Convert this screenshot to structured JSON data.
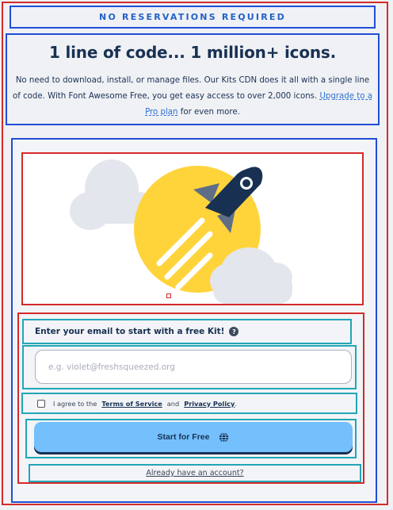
{
  "kicker": "NO RESERVATIONS REQUIRED",
  "intro": {
    "heading": "1 line of code... 1 million+ icons.",
    "body": "No need to download, install, or manage files. Our Kits CDN does it all with a single line of code. With Font Awesome Free, you get easy access to over 2,000 icons.",
    "upgrade_link": "Upgrade to a Pro plan",
    "body_suffix": "for even more."
  },
  "hero": {
    "illustration": "rocket-launch-illustration",
    "colors": {
      "sun": "#ffd43b",
      "rocket": "#183153",
      "cloud": "#e3e6ec"
    }
  },
  "form": {
    "email_label": "Enter your email to start with a free Kit!",
    "help_icon": "question-circle-icon",
    "email_placeholder": "e.g. violet@freshsqueezed.org",
    "terms_prefix": "I agree to the",
    "terms_link": "Terms of Service",
    "terms_and": "and",
    "privacy_link": "Privacy Policy",
    "terms_suffix": ".",
    "cta_label": "Start for Free",
    "cta_icon": "globe-icon",
    "login_link": "Already have an account?"
  },
  "colors": {
    "cta": "#74c0fc",
    "navy": "#183153",
    "link": "#2d6fd1"
  }
}
